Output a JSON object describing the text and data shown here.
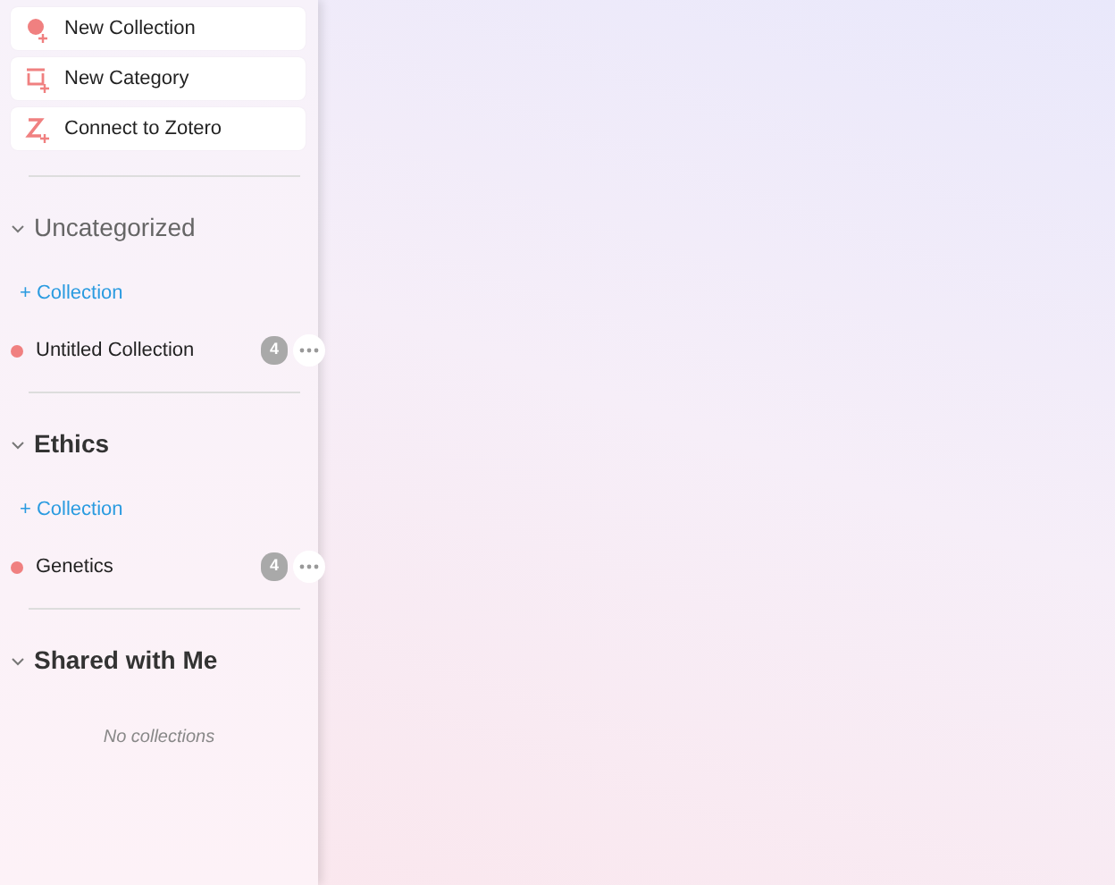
{
  "actions": [
    {
      "kind": "collection",
      "label": "New Collection"
    },
    {
      "kind": "category",
      "label": "New Category"
    },
    {
      "kind": "zotero",
      "label": "Connect to Zotero"
    }
  ],
  "sections": [
    {
      "kind": "default",
      "title": "Uncategorized",
      "expanded": true,
      "add_label": "+ Collection",
      "collections": [
        {
          "name": "Untitled Collection",
          "count": "4",
          "color": "#f08080"
        }
      ]
    },
    {
      "kind": "named",
      "title": "Ethics",
      "expanded": true,
      "add_label": "+ Collection",
      "collections": [
        {
          "name": "Genetics",
          "count": "4",
          "color": "#f08080"
        }
      ]
    },
    {
      "kind": "named",
      "title": "Shared with Me",
      "expanded": true,
      "empty_text": "No collections"
    }
  ]
}
